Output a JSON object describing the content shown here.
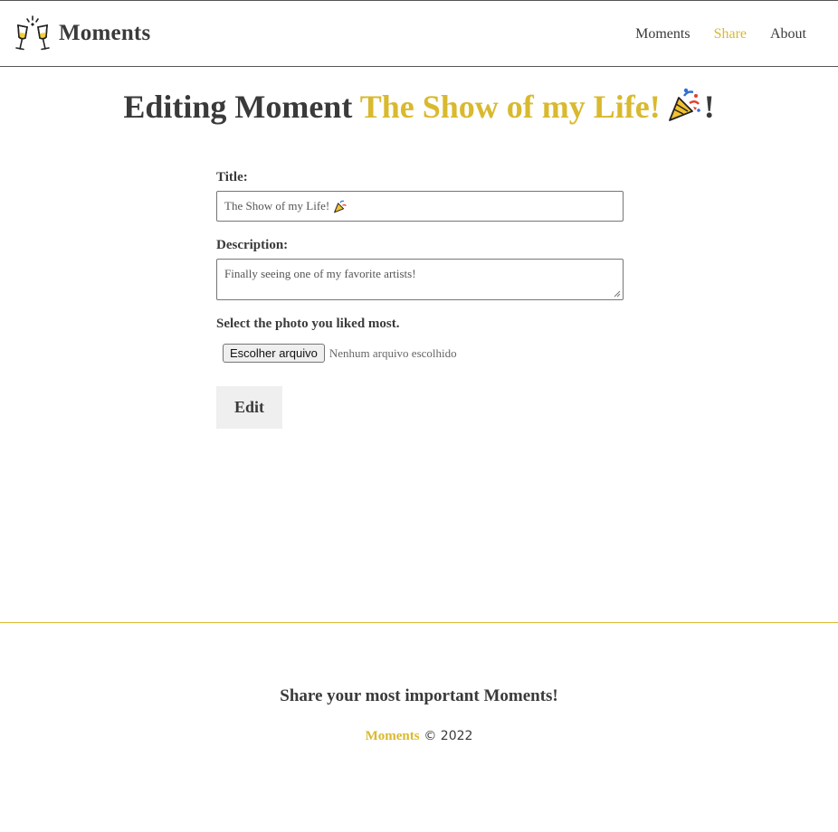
{
  "header": {
    "brand": "Moments",
    "logo_icon": "champagne-toast-icon",
    "nav": [
      {
        "label": "Moments",
        "active": false
      },
      {
        "label": "Share",
        "active": true
      },
      {
        "label": "About",
        "active": false
      }
    ]
  },
  "page": {
    "title_prefix": "Editing Moment",
    "title_highlight": "The Show of my Life!",
    "title_icon": "party-popper-icon",
    "title_suffix": "!"
  },
  "form": {
    "title_label": "Title:",
    "title_value": "The Show of my Life!",
    "description_label": "Description:",
    "description_value": "Finally seeing one of my favorite artists!",
    "photo_label": "Select the photo you liked most.",
    "file_button_label": "Escolher arquivo",
    "file_status": "Nenhum arquivo escolhido",
    "submit_label": "Edit"
  },
  "footer": {
    "tagline": "Share your most important Moments!",
    "brand": "Moments",
    "copyright": "© 2022"
  },
  "colors": {
    "accent": "#d9b92e",
    "text": "#3a3a3a",
    "button_bg": "#efefef"
  }
}
